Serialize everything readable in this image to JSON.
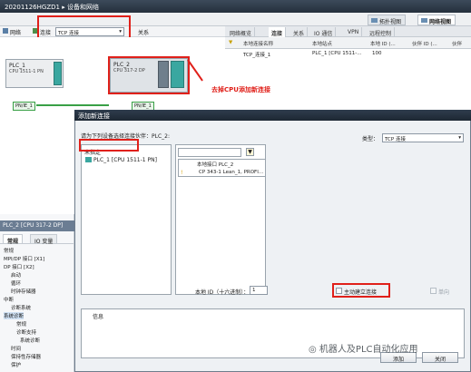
{
  "titlebar": {
    "project": "20201126HGZD1",
    "sep": "▸",
    "page": "设备和网络"
  },
  "viewtabs": {
    "topology": "拓扑视图",
    "network": "网络视图"
  },
  "lefttool": {
    "network_label": "网络",
    "connect_label": "连接",
    "connect_select": "TCP 连接",
    "relation_label": "关系"
  },
  "canvas": {
    "plc1": {
      "name": "PLC_1",
      "cpu": "CPU 1511-1 PN"
    },
    "plc2": {
      "name": "PLC_2",
      "cpu": "CPU 317-2 DP"
    },
    "net1": "PN/IE_1",
    "net2": "PN/IE_1"
  },
  "righttabs": {
    "overview": "网络概览",
    "connections": "连接",
    "relations": "关系",
    "io": "IO 通信",
    "vpn": "VPN",
    "remote": "远程控制"
  },
  "righthead": {
    "c1": "本地连接名称",
    "c2": "本地站点",
    "c3": "本地 ID (...",
    "c4": "伙伴 ID (...",
    "c5": "伙伴"
  },
  "rightrow": {
    "name": "TCP_连接_1",
    "station": "PLC_1 [CPU 1511-...",
    "id": "100"
  },
  "annotation": "去掉CPU添加新连接",
  "properties": {
    "title": "PLC_2 [CPU 317-2 DP]",
    "tabs": {
      "general": "常规",
      "io": "IO 变量"
    },
    "tree": [
      "常规",
      "MPI/DP 接口 [X1]",
      "DP 接口 [X2]",
      "启动",
      "循环",
      "时钟存储器",
      "中断",
      "诊断系统",
      "系统诊断",
      "常规",
      "诊断支持",
      "系统诊断",
      "时间",
      "保持性存储器",
      "保护"
    ]
  },
  "dialog": {
    "title": "添加新连接",
    "instruction": "请为下列设备选择连接伙伴：PLC_2:",
    "type_label": "类型：",
    "type_value": "TCP 连接",
    "unspecified": "未指定",
    "tree_item": "PLC_1 [CPU 1511-1 PN]",
    "iface_head": "本地接口 PLC_2",
    "iface_item": "CP 343-1 Lean_1, PROFI...",
    "local_id_label": "本地 ID（十六进制）：",
    "local_id_value": "1",
    "active_label": "主动建立连接",
    "oneway_label": "单向",
    "info_label": "信息",
    "add_button": "添加",
    "close_button": "关闭"
  },
  "watermark": "机器人及PLC自动化应用"
}
